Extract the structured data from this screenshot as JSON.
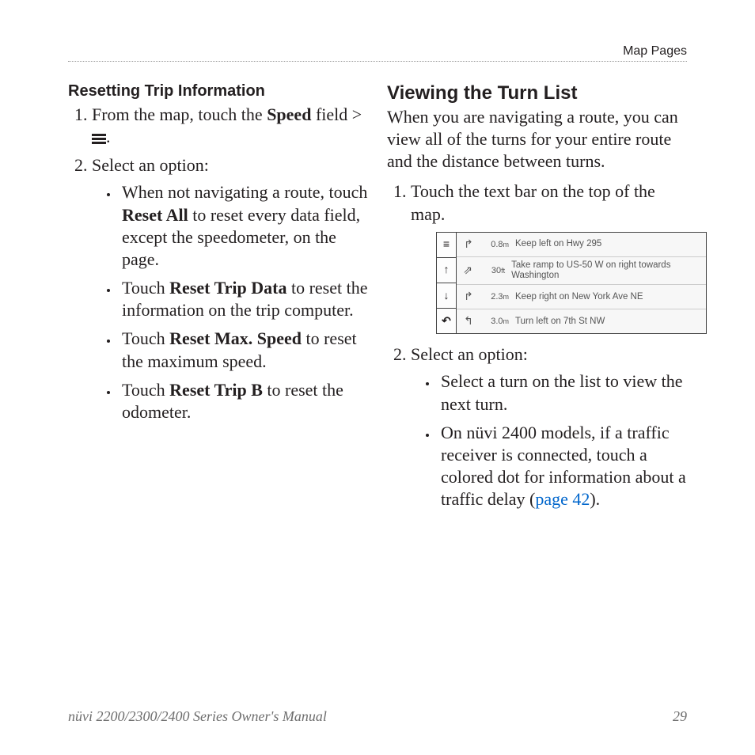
{
  "header": {
    "section": "Map Pages"
  },
  "left": {
    "heading": "Resetting Trip Information",
    "step1_a": "From the map, touch the ",
    "step1_speed": "Speed",
    "step1_b": " field > ",
    "step1_c": ".",
    "step2": "Select an option:",
    "bullets": {
      "b1_a": "When not navigating a route, touch ",
      "b1_bold": "Reset All",
      "b1_b": " to reset every data field, except the speedometer, on the page.",
      "b2_a": "Touch ",
      "b2_bold": "Reset Trip Data",
      "b2_b": " to reset the information on the trip computer.",
      "b3_a": "Touch ",
      "b3_bold": "Reset Max. Speed",
      "b3_b": " to reset the maximum speed.",
      "b4_a": "Touch ",
      "b4_bold": "Reset Trip B",
      "b4_b": " to reset the odometer."
    }
  },
  "right": {
    "heading": "Viewing the Turn List",
    "intro": "When you are navigating a route, you can view all of the turns for your entire route and the distance between turns.",
    "step1": "Touch the text bar on the top of the map.",
    "step2": "Select an option:",
    "bullets": {
      "b1": "Select a turn on the list to view the next turn.",
      "b2_a": "On nüvi 2400 models, if a traffic receiver is connected, touch a colored dot for information about a traffic delay (",
      "b2_link": "page 42",
      "b2_b": ")."
    }
  },
  "turnlist": {
    "side": [
      "≡",
      "↑",
      "↓",
      "↶"
    ],
    "rows": [
      {
        "icon": "↱",
        "dist": "0.8",
        "unit": "m",
        "text": "Keep left on Hwy 295"
      },
      {
        "icon": "⇗",
        "dist": "30",
        "unit": "ft",
        "text": "Take ramp to US-50 W on right towards Washington"
      },
      {
        "icon": "↱",
        "dist": "2.3",
        "unit": "m",
        "text": "Keep right on New York Ave NE"
      },
      {
        "icon": "↰",
        "dist": "3.0",
        "unit": "m",
        "text": "Turn left on 7th St NW"
      }
    ]
  },
  "footer": {
    "left": "nüvi 2200/2300/2400 Series Owner's Manual",
    "right": "29"
  }
}
